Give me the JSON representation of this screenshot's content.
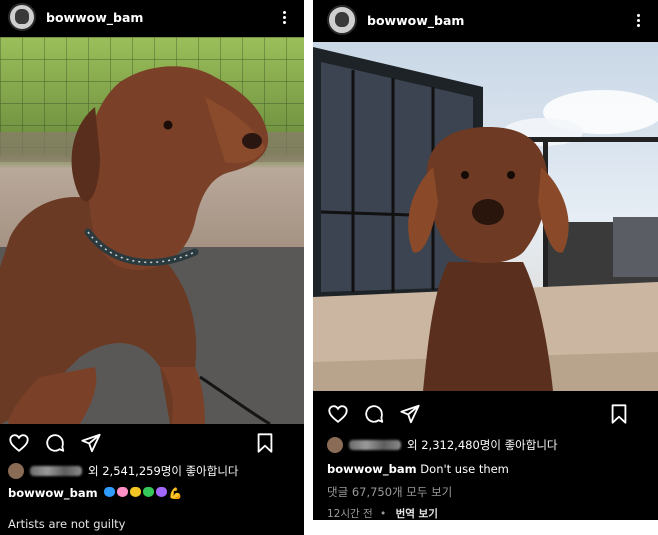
{
  "left_post": {
    "username": "bowwow_bam",
    "likes_text": "외 2,541,259명이 좋아합니다",
    "caption_user": "bowwow_bam",
    "caption_emoji_colors": [
      "#2f9bff",
      "#ff8fc7",
      "#f3c623",
      "#34c759",
      "#a368ff"
    ],
    "caption_emoji_tail": "💪",
    "comment_text": "Artists are not guilty"
  },
  "right_post": {
    "username": "bowwow_bam",
    "likes_text": "외 2,312,480명이 좋아합니다",
    "caption_user": "bowwow_bam",
    "caption_text": "Don't use them",
    "view_comments": "댓글 67,750개 모두 보기",
    "time_ago": "12시간 전",
    "separator": "•",
    "translate_label": "번역 보기"
  },
  "icons": [
    "avatar",
    "more-vert-icon",
    "heart-icon",
    "comment-icon",
    "share-icon",
    "bookmark-icon"
  ]
}
